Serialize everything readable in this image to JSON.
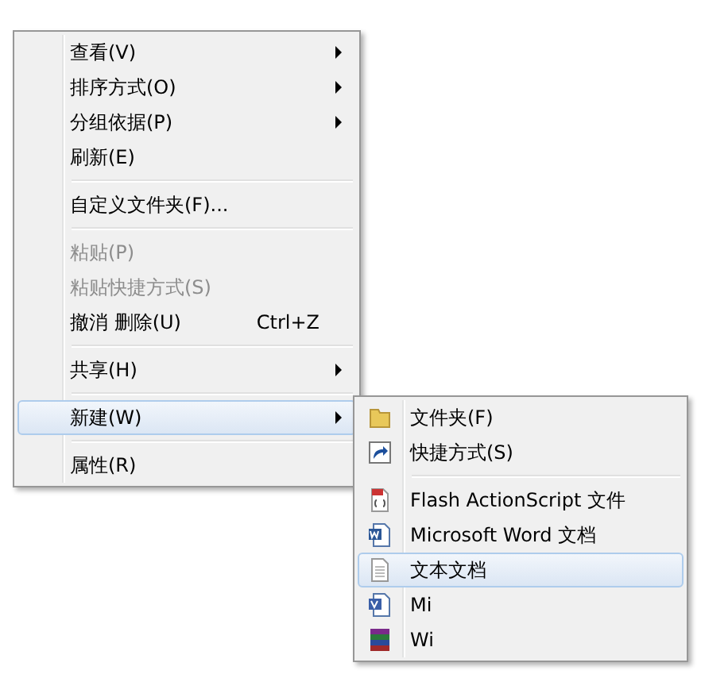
{
  "context_menu": {
    "items": [
      {
        "kind": "item",
        "label": "查看(V)",
        "submenu": true,
        "disabled": false,
        "selected": false
      },
      {
        "kind": "item",
        "label": "排序方式(O)",
        "submenu": true,
        "disabled": false,
        "selected": false
      },
      {
        "kind": "item",
        "label": "分组依据(P)",
        "submenu": true,
        "disabled": false,
        "selected": false
      },
      {
        "kind": "item",
        "label": "刷新(E)",
        "submenu": false,
        "disabled": false,
        "selected": false
      },
      {
        "kind": "separator"
      },
      {
        "kind": "item",
        "label": "自定义文件夹(F)...",
        "submenu": false,
        "disabled": false,
        "selected": false
      },
      {
        "kind": "separator"
      },
      {
        "kind": "item",
        "label": "粘贴(P)",
        "submenu": false,
        "disabled": true,
        "selected": false
      },
      {
        "kind": "item",
        "label": "粘贴快捷方式(S)",
        "submenu": false,
        "disabled": true,
        "selected": false
      },
      {
        "kind": "item",
        "label": "撤消 删除(U)",
        "shortcut": "Ctrl+Z",
        "submenu": false,
        "disabled": false,
        "selected": false
      },
      {
        "kind": "separator"
      },
      {
        "kind": "item",
        "label": "共享(H)",
        "submenu": true,
        "disabled": false,
        "selected": false
      },
      {
        "kind": "separator"
      },
      {
        "kind": "item",
        "label": "新建(W)",
        "submenu": true,
        "disabled": false,
        "selected": true
      },
      {
        "kind": "separator"
      },
      {
        "kind": "item",
        "label": "属性(R)",
        "submenu": false,
        "disabled": false,
        "selected": false
      }
    ]
  },
  "new_submenu": {
    "items": [
      {
        "kind": "item",
        "label": "文件夹(F)",
        "selected": false
      },
      {
        "kind": "item",
        "label": "快捷方式(S)",
        "selected": false
      },
      {
        "kind": "separator"
      },
      {
        "kind": "item",
        "label": "Flash ActionScript 文件",
        "selected": false
      },
      {
        "kind": "item",
        "label": "Microsoft Word 文档",
        "selected": false
      },
      {
        "kind": "item",
        "label": "文本文档",
        "selected": true
      },
      {
        "kind": "item",
        "label": "Mi",
        "selected": false
      },
      {
        "kind": "item",
        "label": "Wi",
        "selected": false
      }
    ]
  }
}
